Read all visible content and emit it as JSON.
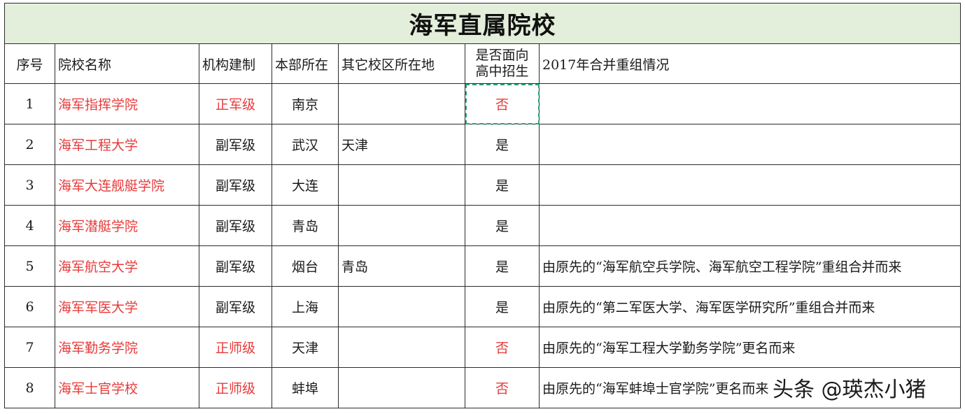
{
  "title": "海军直属院校",
  "headers": [
    "序号",
    "院校名称",
    "机构建制",
    "本部所在",
    "其它校区所在地",
    "是否面向高中招生",
    "2017年合并重组情况"
  ],
  "header_recruit_line1": "是否面向",
  "header_recruit_line2": "高中招生",
  "rows": [
    {
      "no": "1",
      "name": "海军指挥学院",
      "level": "正军级",
      "hq": "南京",
      "other": "",
      "recruit": "否",
      "note": ""
    },
    {
      "no": "2",
      "name": "海军工程大学",
      "level": "副军级",
      "hq": "武汉",
      "other": "天津",
      "recruit": "是",
      "note": ""
    },
    {
      "no": "3",
      "name": "海军大连舰艇学院",
      "level": "副军级",
      "hq": "大连",
      "other": "",
      "recruit": "是",
      "note": ""
    },
    {
      "no": "4",
      "name": "海军潜艇学院",
      "level": "副军级",
      "hq": "青岛",
      "other": "",
      "recruit": "是",
      "note": ""
    },
    {
      "no": "5",
      "name": "海军航空大学",
      "level": "副军级",
      "hq": "烟台",
      "other": "青岛",
      "recruit": "是",
      "note": "由原先的“海军航空兵学院、海军航空工程学院”重组合并而来"
    },
    {
      "no": "6",
      "name": "海军军医大学",
      "level": "副军级",
      "hq": "上海",
      "other": "",
      "recruit": "是",
      "note": "由原先的“第二军医大学、海军医学研究所”重组合并而来"
    },
    {
      "no": "7",
      "name": "海军勤务学院",
      "level": "正师级",
      "hq": "天津",
      "other": "",
      "recruit": "否",
      "note": "由原先的“海军工程大学勤务学院”更名而来"
    },
    {
      "no": "8",
      "name": "海军士官学校",
      "level": "正师级",
      "hq": "蚌埠",
      "other": "",
      "recruit": "否",
      "note": "由原先的“海军蚌埠士官学院”更名而来"
    }
  ],
  "watermark": "头条 @瑛杰小猪",
  "colors": {
    "title_bg": "#e3efda",
    "accent_red": "#e83a3a",
    "selection": "#2aa37a"
  }
}
